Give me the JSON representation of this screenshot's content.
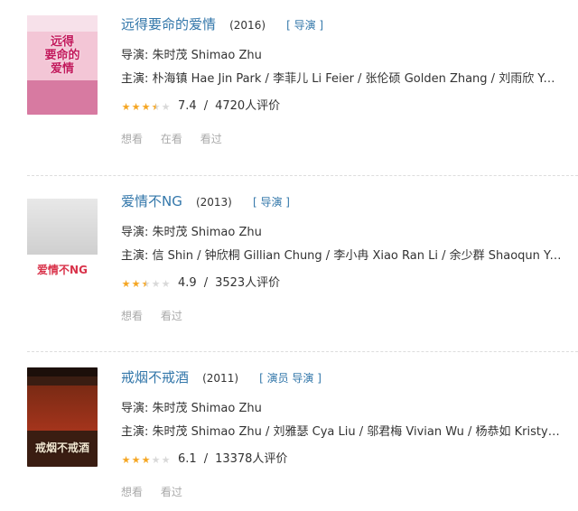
{
  "items": [
    {
      "title": "远得要命的爱情",
      "year": "(2016)",
      "roles": "[ 导演 ]",
      "director": "导演: 朱时茂 Shimao Zhu",
      "cast": "主演: 朴海镇 Hae Jin Park / 李菲儿 Li Feier / 张伦硕 Golden Zhang / 刘雨欣 Yoy...",
      "rating_value": 7.4,
      "rating_text": "7.4",
      "sep": "/",
      "votes": "4720人评价",
      "actions": [
        "想看",
        "在看",
        "看过"
      ],
      "poster_text": "远得\n要命的\n爱情",
      "poster_colors": [
        "#f3c6d6",
        "#d77aa1",
        "#f7e1ea"
      ]
    },
    {
      "title": "爱情不NG",
      "year": "(2013)",
      "roles": "[ 导演 ]",
      "director": "导演: 朱时茂 Shimao Zhu",
      "cast": "主演: 信 Shin / 钟欣桐 Gillian Chung / 李小冉 Xiao Ran Li / 余少群 Shaoqun Yu ...",
      "rating_value": 4.9,
      "rating_text": "4.9",
      "sep": "/",
      "votes": "3523人评价",
      "actions": [
        "想看",
        "看过"
      ],
      "poster_text": "爱情不NG",
      "poster_colors": [
        "#ffffff",
        "#d9324a",
        "#f2f2f2"
      ]
    },
    {
      "title": "戒烟不戒酒",
      "year": "(2011)",
      "roles": "[ 演员 导演 ]",
      "director": "导演: 朱时茂 Shimao Zhu",
      "cast": "主演: 朱时茂 Shimao Zhu / 刘雅瑟 Cya Liu / 邬君梅 Vivian Wu / 杨恭如 Kristy Ya...",
      "rating_value": 6.1,
      "rating_text": "6.1",
      "sep": "/",
      "votes": "13378人评价",
      "actions": [
        "想看",
        "看过"
      ],
      "poster_text": "戒烟不戒酒",
      "poster_colors": [
        "#3a1d12",
        "#a4341c",
        "#1c0f0a"
      ]
    }
  ],
  "colors": {
    "link": "#37a",
    "star": "#f5a623",
    "star_off": "#d9d9d9",
    "muted": "#aaa"
  }
}
